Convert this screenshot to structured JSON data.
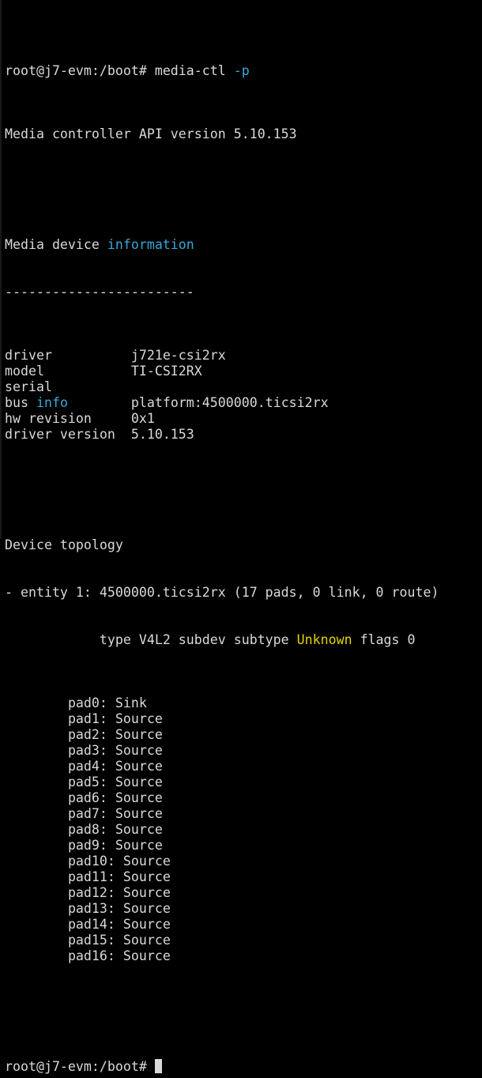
{
  "terminal": {
    "prompt": "root@j7-evm:/boot#",
    "command": "media-ctl",
    "command_flag": "-p",
    "api_version_line": "Media controller API version 5.10.153",
    "info_header_prefix": "Media device ",
    "info_header_highlight": "information",
    "separator": "------------------------",
    "info_fields": [
      {
        "key": "driver",
        "value": "j721e-csi2rx"
      },
      {
        "key": "model",
        "value": "TI-CSI2RX"
      },
      {
        "key": "serial",
        "value": ""
      },
      {
        "key": "bus info",
        "value": "platform:4500000.ticsi2rx"
      },
      {
        "key": "hw revision",
        "value": "0x1"
      },
      {
        "key": "driver version",
        "value": "5.10.153"
      }
    ],
    "topology_header": "Device topology",
    "entity_line": "- entity 1: 4500000.ticsi2rx (17 pads, 0 link, 0 route)",
    "type_prefix": "type V4L2 subdev subtype ",
    "type_highlight": "Unknown",
    "type_suffix": " flags 0",
    "pads": [
      "pad0: Sink",
      "pad1: Source",
      "pad2: Source",
      "pad3: Source",
      "pad4: Source",
      "pad5: Source",
      "pad6: Source",
      "pad7: Source",
      "pad8: Source",
      "pad9: Source",
      "pad10: Source",
      "pad11: Source",
      "pad12: Source",
      "pad13: Source",
      "pad14: Source",
      "pad15: Source",
      "pad16: Source"
    ]
  },
  "colors": {
    "background": "#000000",
    "text": "#d9d9d9",
    "keyword_blue": "#3aa6d9",
    "keyword_yellow": "#e6d200"
  }
}
